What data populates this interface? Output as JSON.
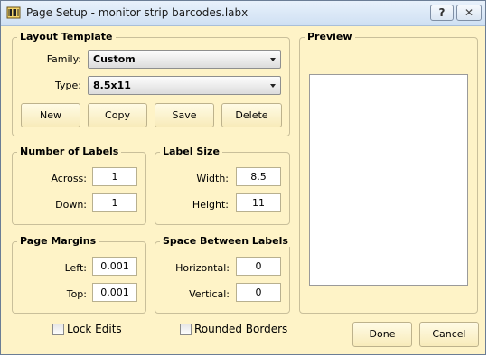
{
  "window": {
    "title": "Page Setup - monitor strip barcodes.labx",
    "help_label": "?",
    "close_label": "✕"
  },
  "layout_template": {
    "legend": "Layout Template",
    "family_label": "Family:",
    "family_value": "Custom",
    "type_label": "Type:",
    "type_value": "8.5x11",
    "buttons": {
      "new": "New",
      "copy": "Copy",
      "save": "Save",
      "delete": "Delete"
    }
  },
  "number_of_labels": {
    "legend": "Number of Labels",
    "across_label": "Across:",
    "across_value": "1",
    "down_label": "Down:",
    "down_value": "1"
  },
  "label_size": {
    "legend": "Label Size",
    "width_label": "Width:",
    "width_value": "8.5",
    "height_label": "Height:",
    "height_value": "11"
  },
  "page_margins": {
    "legend": "Page Margins",
    "left_label": "Left:",
    "left_value": "0.001",
    "top_label": "Top:",
    "top_value": "0.001"
  },
  "space_between": {
    "legend": "Space Between Labels",
    "horizontal_label": "Horizontal:",
    "horizontal_value": "0",
    "vertical_label": "Vertical:",
    "vertical_value": "0"
  },
  "preview": {
    "legend": "Preview"
  },
  "options": {
    "lock_edits": "Lock Edits",
    "rounded_borders": "Rounded Borders"
  },
  "actions": {
    "done": "Done",
    "cancel": "Cancel"
  },
  "icons": {
    "app": "app-icon",
    "caret": "chevron-down-icon"
  }
}
